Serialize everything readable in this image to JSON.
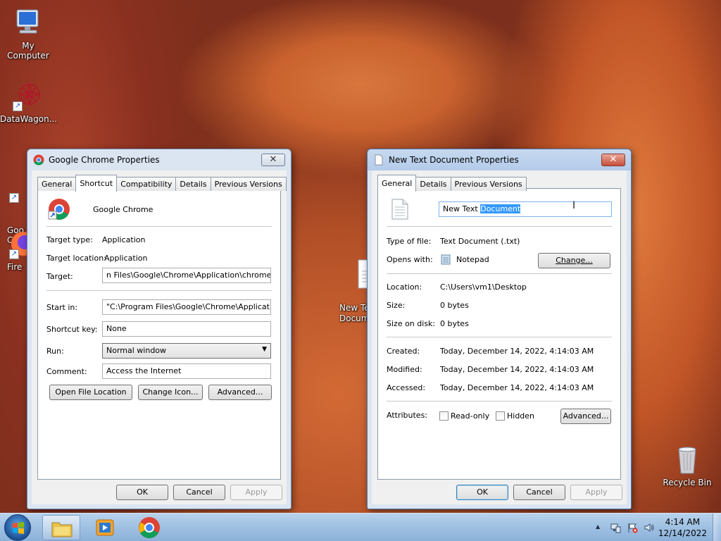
{
  "desktop": {
    "icons": [
      {
        "label": "My Computer"
      },
      {
        "label": "DataWagon..."
      },
      {
        "label": "Goo\nChro"
      },
      {
        "label": "Fire"
      },
      {
        "label": "New Te\nDocume"
      },
      {
        "label": "Recycle Bin"
      }
    ]
  },
  "chrome_props": {
    "title": "Google Chrome Properties",
    "close": "✕",
    "tabs": [
      "General",
      "Shortcut",
      "Compatibility",
      "Details",
      "Previous Versions"
    ],
    "active_tab": "Shortcut",
    "app_name": "Google Chrome",
    "target_type_label": "Target type:",
    "target_type": "Application",
    "target_location_label": "Target location:",
    "target_location": "Application",
    "target_label": "Target:",
    "target": "n Files\\Google\\Chrome\\Application\\chrome.exe\"",
    "start_in_label": "Start in:",
    "start_in": "\"C:\\Program Files\\Google\\Chrome\\Application\"",
    "shortcut_key_label": "Shortcut key:",
    "shortcut_key": "None",
    "run_label": "Run:",
    "run": "Normal window",
    "comment_label": "Comment:",
    "comment": "Access the Internet",
    "open_file_location": "Open File Location",
    "change_icon": "Change Icon...",
    "advanced": "Advanced...",
    "ok": "OK",
    "cancel": "Cancel",
    "apply": "Apply"
  },
  "text_props": {
    "title": "New Text Document Properties",
    "close": "✕",
    "tabs": [
      "General",
      "Details",
      "Previous Versions"
    ],
    "active_tab": "General",
    "name_prefix": "New Text ",
    "name_selected": "Document",
    "type_label": "Type of file:",
    "type": "Text Document (.txt)",
    "opens_label": "Opens with:",
    "opens": "Notepad",
    "change": "Change...",
    "location_label": "Location:",
    "location": "C:\\Users\\vm1\\Desktop",
    "size_label": "Size:",
    "size": "0 bytes",
    "size_disk_label": "Size on disk:",
    "size_disk": "0 bytes",
    "created_label": "Created:",
    "created": "Today, December 14, 2022, 4:14:03 AM",
    "modified_label": "Modified:",
    "modified": "Today, December 14, 2022, 4:14:03 AM",
    "accessed_label": "Accessed:",
    "accessed": "Today, December 14, 2022, 4:14:03 AM",
    "attributes_label": "Attributes:",
    "readonly": "Read-only",
    "hidden": "Hidden",
    "advanced": "Advanced...",
    "ok": "OK",
    "cancel": "Cancel",
    "apply": "Apply"
  },
  "taskbar": {
    "time": "4:14 AM",
    "date": "12/14/2022",
    "tray_arrow": "▲"
  }
}
